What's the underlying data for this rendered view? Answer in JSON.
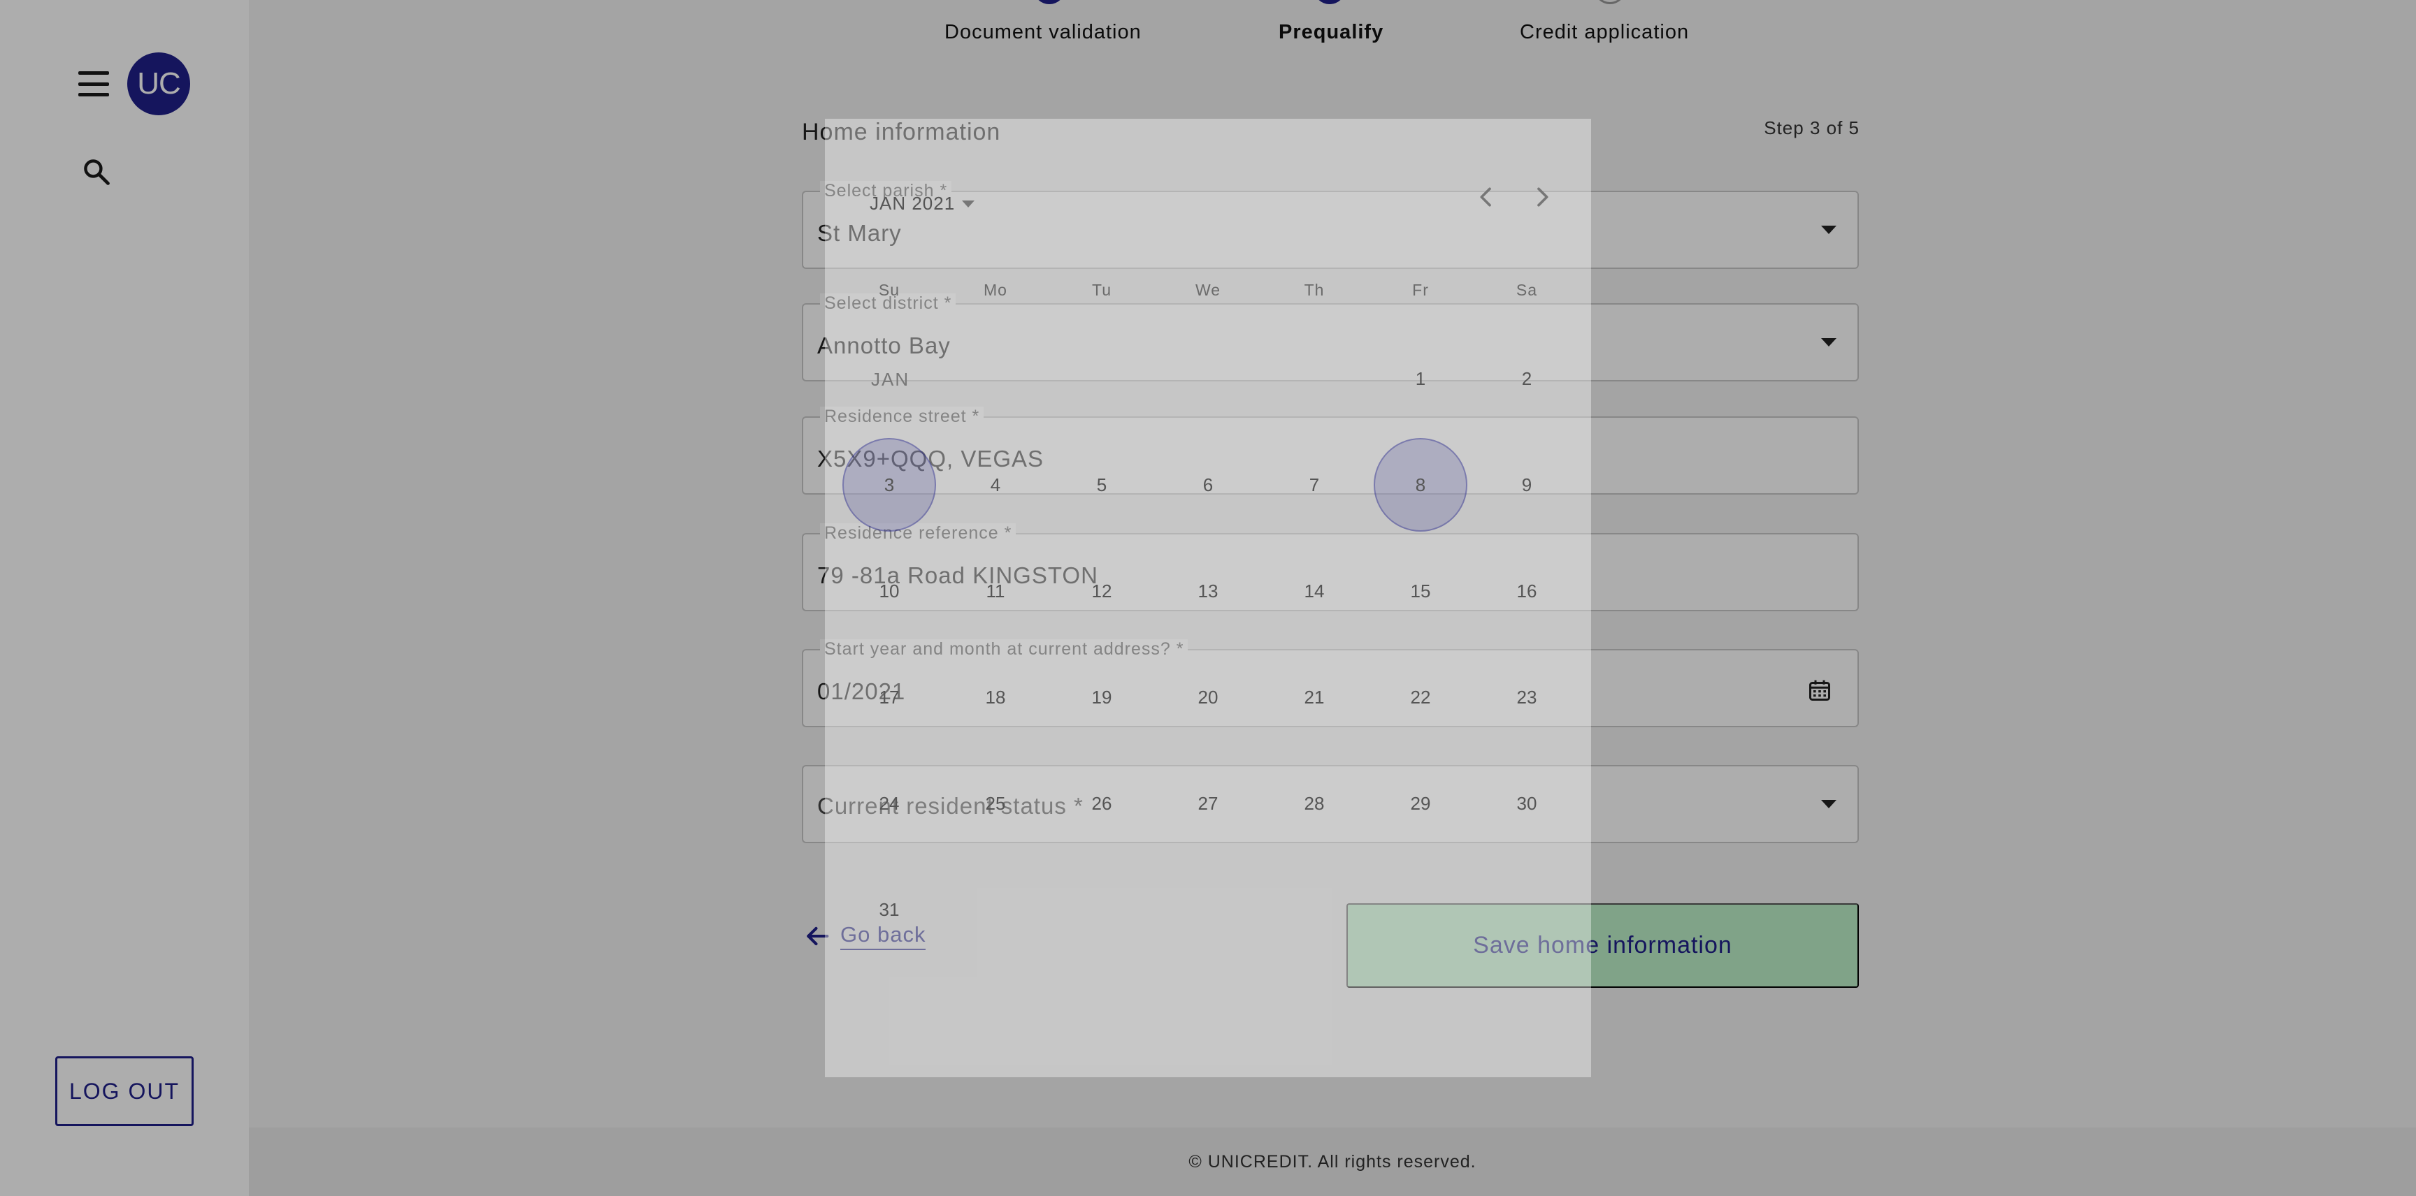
{
  "sidebar": {
    "avatar_initials": "UC",
    "logout_label": "LOG OUT"
  },
  "stepper": {
    "steps": [
      {
        "label": "Document validation",
        "state": "done"
      },
      {
        "label": "Prequalify",
        "state": "active"
      },
      {
        "label": "Credit application",
        "state": "pending"
      }
    ]
  },
  "form": {
    "title": "Home information",
    "step_count": "Step 3 of 5",
    "fields": [
      {
        "label": "Select parish *",
        "value": "St Mary",
        "type": "select"
      },
      {
        "label": "Select district *",
        "value": "Annotto Bay",
        "type": "select"
      },
      {
        "label": "Residence street *",
        "value": "X5X9+QQQ, VEGAS",
        "type": "text"
      },
      {
        "label": "Residence reference *",
        "value": "79 -81a Road KINGSTON",
        "type": "text"
      },
      {
        "label": "Start year and month at current address? *",
        "value": "01/2021",
        "type": "date"
      },
      {
        "placeholder": "Current resident status *",
        "type": "select"
      }
    ],
    "go_back_label": "Go back",
    "save_label": "Save home information"
  },
  "date_picker": {
    "month_year": "JAN 2021",
    "month_short": "JAN",
    "weekdays": [
      "Su",
      "Mo",
      "Tu",
      "We",
      "Th",
      "Fr",
      "Sa"
    ],
    "days": [
      "1",
      "2",
      "3",
      "4",
      "5",
      "6",
      "7",
      "8",
      "9",
      "10",
      "11",
      "12",
      "13",
      "14",
      "15",
      "16",
      "17",
      "18",
      "19",
      "20",
      "21",
      "22",
      "23",
      "24",
      "25",
      "26",
      "27",
      "28",
      "29",
      "30",
      "31"
    ],
    "first_weekday_index": 5,
    "highlighted_days": [
      "3",
      "8"
    ]
  },
  "footer": {
    "text": "© UNICREDIT. All rights reserved."
  },
  "colors": {
    "brand": "#1f1f8a",
    "save_button": "#bdf0c9",
    "overlay": "#000000"
  }
}
